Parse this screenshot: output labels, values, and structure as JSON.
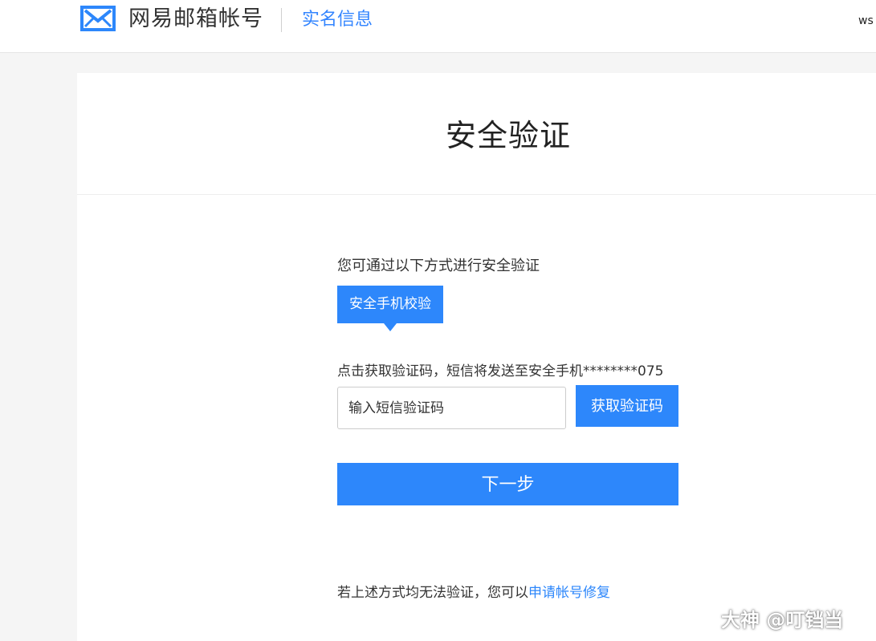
{
  "header": {
    "logo_icon": "mail-envelope-icon",
    "brand_title": "网易邮箱帐号",
    "subtitle": "实名信息",
    "user_short": "ws",
    "accent_color": "#3385ff"
  },
  "main": {
    "title": "安全验证",
    "intro": "您可通过以下方式进行安全验证",
    "method_tab": "安全手机校验",
    "sms_hint": "点击获取验证码，短信将发送至安全手机********075",
    "code_input": {
      "placeholder": "输入短信验证码",
      "value": ""
    },
    "get_code_button": "获取验证码",
    "next_button": "下一步",
    "fallback": {
      "text": "若上述方式均无法验证，您可以",
      "link": "申请帐号修复"
    },
    "button_color": "#2d87fb"
  },
  "watermark": {
    "text": "大神 @叮铛当"
  }
}
